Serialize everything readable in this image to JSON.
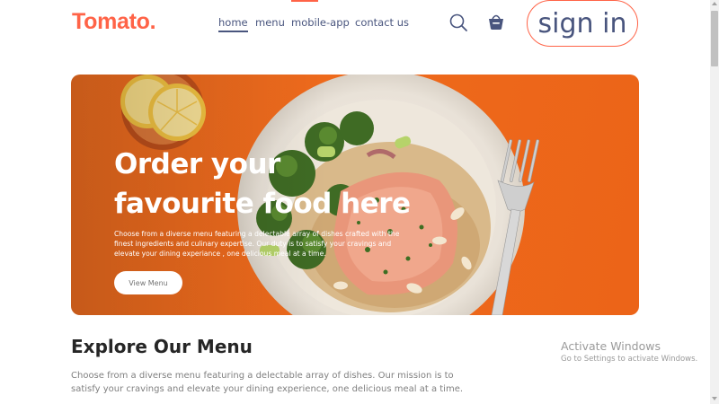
{
  "navbar": {
    "logo": "Tomato.",
    "menu": [
      {
        "label": "home",
        "active": true
      },
      {
        "label": "menu",
        "active": false
      },
      {
        "label": "mobile-app",
        "active": false
      },
      {
        "label": "contact us",
        "active": false
      }
    ],
    "icons": [
      "search-icon",
      "basket-icon"
    ],
    "signin_label": "sign in"
  },
  "hero": {
    "title_line1": "Order your",
    "title_line2": "favourite food here",
    "text": "Choose from a diverse menu featuring a delectable array of dishes crafted with the finest ingredients and culinary expertise. Our duty is to satisfy your cravings and elevate your dining experiance , one delicious meal at a time.",
    "button_label": "View Menu"
  },
  "explore": {
    "title": "Explore Our Menu",
    "text": "Choose from a diverse menu featuring a delectable array of dishes. Our mission is to satisfy your cravings and elevate your dining experience, one delicious meal at a time."
  },
  "watermark": {
    "title": "Activate Windows",
    "subtitle": "Go to Settings to activate Windows."
  },
  "colors": {
    "brand": "#ff6347",
    "nav_text": "#49557e",
    "hero_bg": "#f06c1e"
  }
}
